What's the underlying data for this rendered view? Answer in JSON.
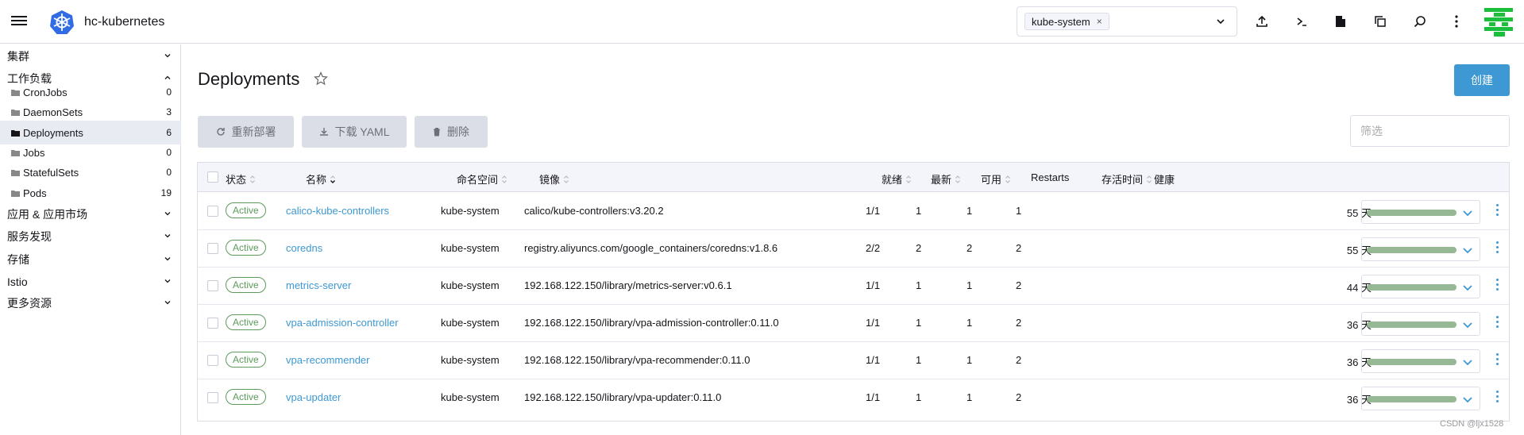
{
  "header": {
    "cluster_name": "hc-kubernetes",
    "namespace_selected": "kube-system",
    "namespace_remove": "×",
    "icons": [
      "upload-icon",
      "terminal-icon",
      "file-icon",
      "copy-icon",
      "search-icon",
      "more-vertical-icon"
    ],
    "brand_color": "#3d98d3"
  },
  "sidebar": {
    "groups": [
      {
        "label": "集群"
      },
      {
        "label": "工作负载"
      },
      {
        "label": "应用 & 应用市场"
      },
      {
        "label": "服务发现"
      },
      {
        "label": "存储"
      },
      {
        "label": "Istio"
      },
      {
        "label": "更多资源"
      }
    ],
    "items": [
      {
        "label": "CronJobs",
        "count": "0"
      },
      {
        "label": "DaemonSets",
        "count": "3"
      },
      {
        "label": "Deployments",
        "count": "6"
      },
      {
        "label": "Jobs",
        "count": "0"
      },
      {
        "label": "StatefulSets",
        "count": "0"
      },
      {
        "label": "Pods",
        "count": "19"
      }
    ]
  },
  "main": {
    "title": "Deployments",
    "create_label": "创建",
    "redeploy_label": "重新部署",
    "download_label": "下载 YAML",
    "delete_label": "删除",
    "filter_placeholder": "筛选"
  },
  "table": {
    "columns": {
      "state": "状态",
      "name": "名称",
      "namespace": "命名空间",
      "image": "镜像",
      "ready": "就绪",
      "uptodate": "最新",
      "available": "可用",
      "restarts": "Restarts",
      "age": "存活时间",
      "health": "健康"
    },
    "rows": [
      {
        "state": "Active",
        "name": "calico-kube-controllers",
        "namespace": "kube-system",
        "image": "calico/kube-controllers:v3.20.2",
        "ready": "1/1",
        "uptodate": "1",
        "available": "1",
        "restarts": "1",
        "age": "55 天"
      },
      {
        "state": "Active",
        "name": "coredns",
        "namespace": "kube-system",
        "image": "registry.aliyuncs.com/google_containers/coredns:v1.8.6",
        "ready": "2/2",
        "uptodate": "2",
        "available": "2",
        "restarts": "2",
        "age": "55 天"
      },
      {
        "state": "Active",
        "name": "metrics-server",
        "namespace": "kube-system",
        "image": "192.168.122.150/library/metrics-server:v0.6.1",
        "ready": "1/1",
        "uptodate": "1",
        "available": "1",
        "restarts": "2",
        "age": "44 天"
      },
      {
        "state": "Active",
        "name": "vpa-admission-controller",
        "namespace": "kube-system",
        "image": "192.168.122.150/library/vpa-admission-controller:0.11.0",
        "ready": "1/1",
        "uptodate": "1",
        "available": "1",
        "restarts": "2",
        "age": "36 天"
      },
      {
        "state": "Active",
        "name": "vpa-recommender",
        "namespace": "kube-system",
        "image": "192.168.122.150/library/vpa-recommender:0.11.0",
        "ready": "1/1",
        "uptodate": "1",
        "available": "1",
        "restarts": "2",
        "age": "36 天"
      },
      {
        "state": "Active",
        "name": "vpa-updater",
        "namespace": "kube-system",
        "image": "192.168.122.150/library/vpa-updater:0.11.0",
        "ready": "1/1",
        "uptodate": "1",
        "available": "1",
        "restarts": "2",
        "age": "36 天"
      }
    ]
  },
  "watermark": "CSDN @ljx1528"
}
